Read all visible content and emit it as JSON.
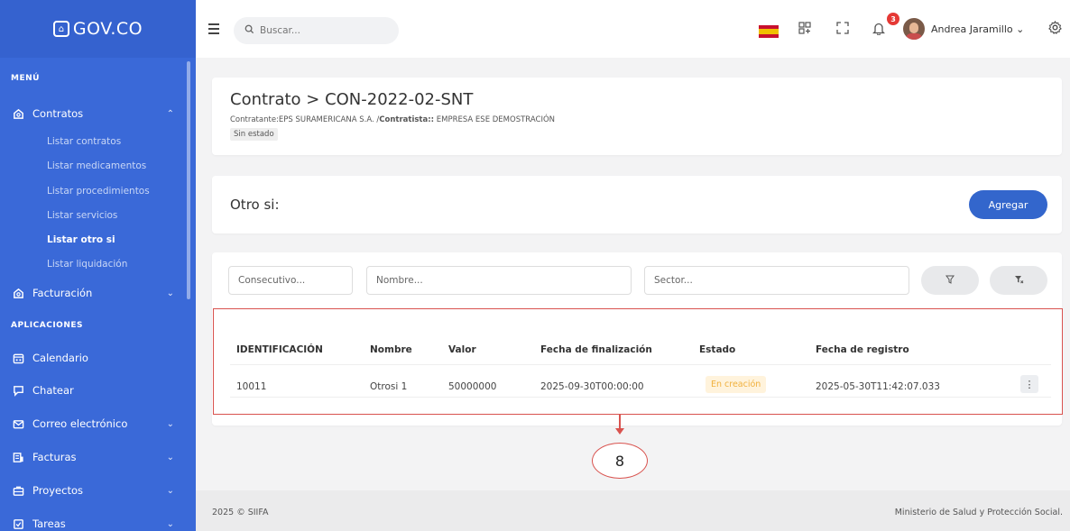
{
  "brand": {
    "name": "GOV.CO"
  },
  "sidebar": {
    "section_menu": "MENÚ",
    "contratos": {
      "label": "Contratos"
    },
    "sub_items": [
      "Listar contratos",
      "Listar medicamentos",
      "Listar procedimientos",
      "Listar servicios",
      "Listar otro si",
      "Listar liquidación"
    ],
    "facturacion": {
      "label": "Facturación"
    },
    "section_apps": "APLICACIONES",
    "apps": [
      "Calendario",
      "Chatear",
      "Correo electrónico",
      "Facturas",
      "Proyectos",
      "Tareas"
    ]
  },
  "topbar": {
    "search_placeholder": "Buscar...",
    "notifications_count": "3",
    "user_name": "Andrea Jaramillo"
  },
  "contract": {
    "title": "Contrato > CON-2022-02-SNT",
    "contratante_label": "Contratante:",
    "contratante_value": "EPS SURAMERICANA S.A. /",
    "contratista_label": "Contratista::",
    "contratista_value": " EMPRESA ESE DEMOSTRACIÓN",
    "status": "Sin estado"
  },
  "otrosi": {
    "title": "Otro si:",
    "add_button": "Agregar"
  },
  "filters": {
    "consecutivo_placeholder": "Consecutivo...",
    "nombre_placeholder": "Nombre...",
    "sector_placeholder": "Sector..."
  },
  "table": {
    "headers": [
      "IDENTIFICACIÓN",
      "Nombre",
      "Valor",
      "Fecha de finalización",
      "Estado",
      "Fecha de registro"
    ],
    "rows": [
      {
        "id": "10011",
        "nombre": "Otrosi 1",
        "valor": "50000000",
        "fecha_fin": "2025-09-30T00:00:00",
        "estado": "En creación",
        "fecha_registro": "2025-05-30T11:42:07.033"
      }
    ]
  },
  "annotation": {
    "number": "8"
  },
  "footer": {
    "left": "2025 © SIIFA",
    "right": "Ministerio de Salud y Protección Social."
  }
}
